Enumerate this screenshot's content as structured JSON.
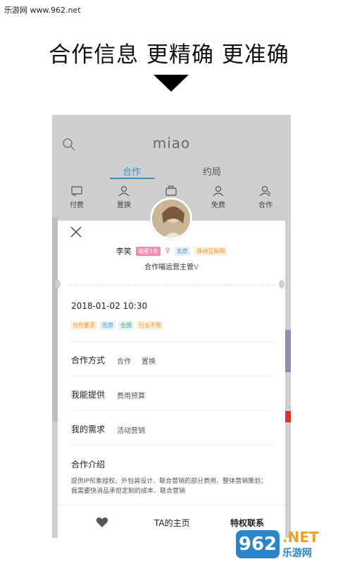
{
  "watermark_top": "乐游网 www.962.net",
  "headline": "合作信息 更精确 更准确",
  "app": {
    "logo": "miao",
    "tabs": [
      {
        "label": "合作",
        "active": true
      },
      {
        "label": "约局",
        "active": false
      }
    ],
    "categories": [
      {
        "label": "付费",
        "icon": "payment-icon"
      },
      {
        "label": "置换",
        "icon": "exchange-icon"
      },
      {
        "label": "",
        "icon": "briefcase-icon"
      },
      {
        "label": "免费",
        "icon": "free-icon"
      },
      {
        "label": "合作",
        "icon": "cooperate-icon"
      }
    ],
    "accent_color": "#3a8fc0"
  },
  "card": {
    "name": "李笑",
    "badge_level": "喵星1年",
    "city": "北京",
    "industry": "移动互联网",
    "title": "合作喵运营主管",
    "verified_mark": "V",
    "datetime": "2018-01-02 10:30",
    "requirement_tags": [
      "合作要求",
      "北京",
      "全国",
      "行业不限"
    ],
    "rows": [
      {
        "label": "合作方式",
        "values": [
          "合作",
          "置换"
        ]
      },
      {
        "label": "我能提供",
        "values": [
          "费用预算"
        ]
      },
      {
        "label": "我的需求",
        "values": [
          "活动营销"
        ]
      }
    ],
    "intro_title": "合作介绍",
    "intro_text": "提供IP形象授权、外包装设计、联合营销的部分费用、整体营销策划；我需要快消品承担定制的成本、联合营销"
  },
  "bottom_bar": {
    "home_label": "TA的主页",
    "privilege_label": "特权联系"
  },
  "watermark_logo": {
    "number": "962",
    "net": ".NET",
    "cn": "乐游网"
  }
}
